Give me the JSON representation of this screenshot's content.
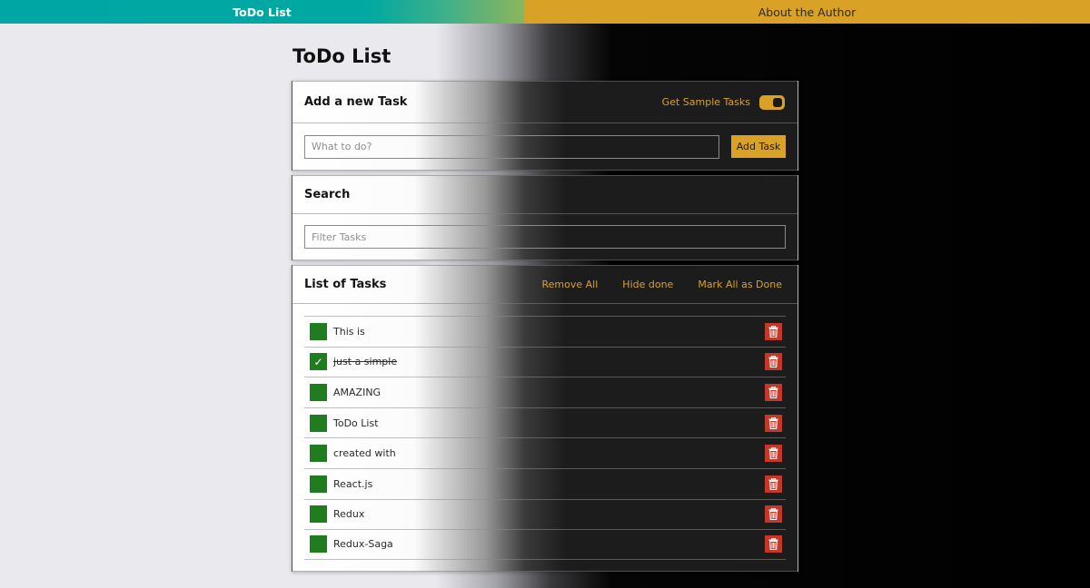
{
  "nav": {
    "home_label": "ToDo List",
    "about_label": "About the Author"
  },
  "page": {
    "title": "ToDo List"
  },
  "add_task": {
    "title": "Add a new Task",
    "sample_label": "Get Sample Tasks",
    "sample_enabled": true,
    "input_placeholder": "What to do?",
    "input_value": "",
    "button_label": "Add Task"
  },
  "search": {
    "title": "Search",
    "input_placeholder": "Filter Tasks",
    "input_value": ""
  },
  "list": {
    "title": "List of Tasks",
    "remove_all_label": "Remove All",
    "hide_done_label": "Hide done",
    "mark_all_label": "Mark All as Done",
    "tasks": [
      {
        "text": "This is",
        "done": false
      },
      {
        "text": "just a simple",
        "done": true
      },
      {
        "text": "AMAZING",
        "done": false
      },
      {
        "text": "ToDo List",
        "done": false
      },
      {
        "text": "created with",
        "done": false
      },
      {
        "text": "React.js",
        "done": false
      },
      {
        "text": "Redux",
        "done": false
      },
      {
        "text": "Redux-Saga",
        "done": false
      }
    ]
  },
  "icons": {
    "check": "checkmark-icon",
    "delete": "trash-icon"
  },
  "colors": {
    "accent": "#d9a227",
    "nav_left": "#00a6a4",
    "checkbox": "#1f7d1f",
    "delete": "#c0392b"
  }
}
